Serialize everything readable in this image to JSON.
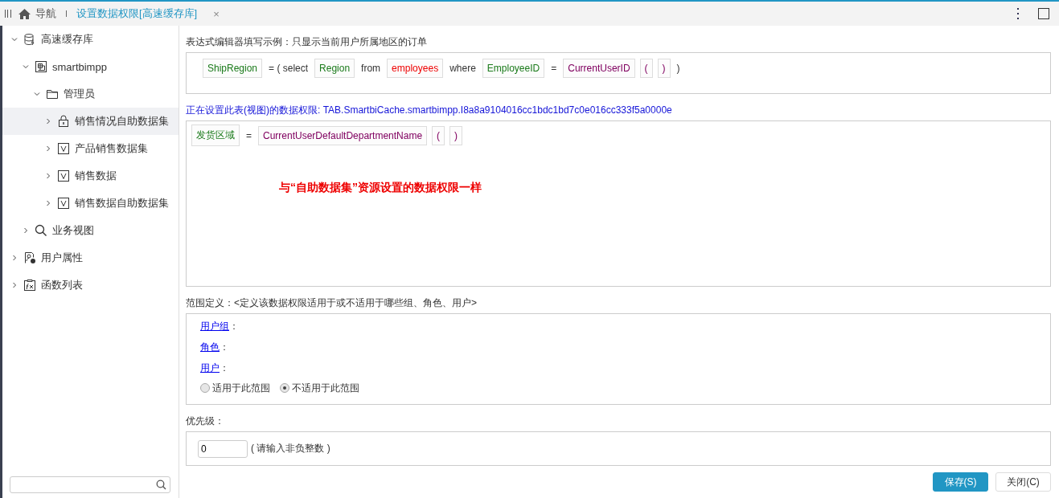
{
  "tabs": [
    {
      "label": "导航",
      "kind": "home",
      "selected": false
    },
    {
      "label": "设置数据权限[高速缓存库]",
      "kind": "doc",
      "selected": true,
      "closable": "×"
    }
  ],
  "tree": [
    {
      "label": "高速缓存库",
      "kind": "database",
      "expanded": true,
      "selected": false,
      "children": [
        {
          "label": "smartbimpp",
          "kind": "table",
          "expanded": true,
          "selected": false,
          "children": [
            {
              "label": "管理员",
              "kind": "folder",
              "expanded": true,
              "selected": false,
              "children": [
                {
                  "label": "销售情况自助数据集",
                  "kind": "lock",
                  "expanded": false,
                  "selected": true
                },
                {
                  "label": "产品销售数据集",
                  "kind": "view",
                  "expanded": false,
                  "selected": false
                },
                {
                  "label": "销售数据",
                  "kind": "view",
                  "expanded": false,
                  "selected": false
                },
                {
                  "label": "销售数据自助数据集",
                  "kind": "view",
                  "expanded": false,
                  "selected": false
                }
              ]
            }
          ]
        },
        {
          "label": "业务视图",
          "kind": "search",
          "expanded": false,
          "selected": false
        }
      ]
    },
    {
      "label": "用户属性",
      "kind": "user",
      "expanded": false,
      "selected": false
    },
    {
      "label": "函数列表",
      "kind": "function",
      "expanded": false,
      "selected": false
    }
  ],
  "example": {
    "label": "表达式编辑器填写示例：只显示当前用户所属地区的订单",
    "tokens": [
      {
        "text": "ShipRegion",
        "kind": "field"
      },
      {
        "text": "= ( select",
        "kind": "text"
      },
      {
        "text": "Region",
        "kind": "field"
      },
      {
        "text": "from",
        "kind": "text"
      },
      {
        "text": "employees",
        "kind": "table"
      },
      {
        "text": "where",
        "kind": "text"
      },
      {
        "text": "EmployeeID",
        "kind": "field"
      },
      {
        "text": "=",
        "kind": "text"
      },
      {
        "text": "CurrentUserID",
        "kind": "func"
      },
      {
        "text": "(",
        "kind": "func"
      },
      {
        "text": ")",
        "kind": "func"
      },
      {
        "text": ")",
        "kind": "text"
      }
    ]
  },
  "editor": {
    "label": "正在设置此表(视图)的数据权限: TAB.SmartbiCache.smartbimpp.I8a8a9104016cc1bdc1bd7c0e016cc333f5a0000e",
    "tokens": [
      {
        "text": "发货区域",
        "kind": "field"
      },
      {
        "text": "=",
        "kind": "text"
      },
      {
        "text": "CurrentUserDefaultDepartmentName",
        "kind": "func"
      },
      {
        "text": "(",
        "kind": "func"
      },
      {
        "text": ")",
        "kind": "func"
      }
    ],
    "annotation": "与“自助数据集”资源设置的数据权限一样"
  },
  "scope": {
    "label": "范围定义：<定义该数据权限适用于或不适用于哪些组、角色、用户>",
    "links": [
      {
        "text": "用户组",
        "suffix": "："
      },
      {
        "text": "角色",
        "suffix": "："
      },
      {
        "text": "用户",
        "suffix": "："
      }
    ],
    "options": [
      {
        "label": "适用于此范围",
        "selected": false
      },
      {
        "label": "不适用于此范围",
        "selected": true
      }
    ]
  },
  "priority": {
    "label": "优先级：",
    "value": "0",
    "hint": "( 请输入非负整数 )"
  },
  "buttons": [
    {
      "label": "保存(S)",
      "kind": "primary"
    },
    {
      "label": "关闭(C)",
      "kind": "default"
    }
  ]
}
